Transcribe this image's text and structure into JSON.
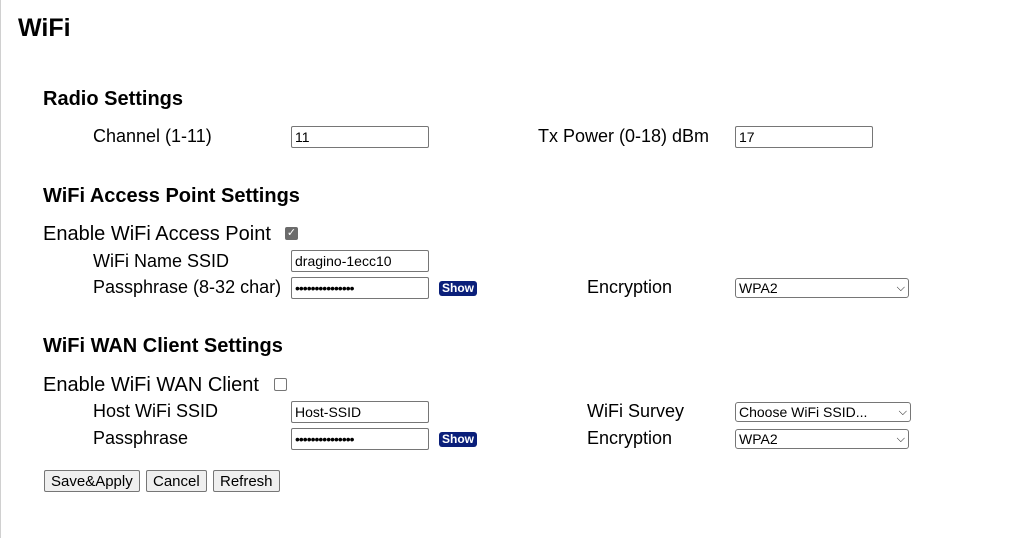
{
  "page": {
    "title": "WiFi"
  },
  "radio": {
    "title": "Radio Settings",
    "channel_label": "Channel (1-11)",
    "channel_value": "11",
    "txpower_label": "Tx Power (0-18) dBm",
    "txpower_value": "17"
  },
  "ap": {
    "title": "WiFi Access Point Settings",
    "enable_label": "Enable WiFi Access Point",
    "enabled": true,
    "ssid_label": "WiFi Name SSID",
    "ssid_value": "dragino-1ecc10",
    "pass_label": "Passphrase (8-32 char)",
    "pass_value": "•••••••••••••••",
    "show_label": "Show",
    "enc_label": "Encryption",
    "enc_value": "WPA2"
  },
  "wan": {
    "title": "WiFi WAN Client Settings",
    "enable_label": "Enable WiFi WAN Client",
    "enabled": false,
    "ssid_label": "Host WiFi SSID",
    "ssid_value": "Host-SSID",
    "survey_label": "WiFi Survey",
    "survey_value": "Choose WiFi SSID...",
    "pass_label": "Passphrase",
    "pass_value": "•••••••••••••••",
    "show_label": "Show",
    "enc_label": "Encryption",
    "enc_value": "WPA2"
  },
  "actions": {
    "save_label": "Save&Apply",
    "cancel_label": "Cancel",
    "refresh_label": "Refresh"
  },
  "colors": {
    "show_button": "#0a1f7a"
  },
  "icons": {
    "dropdown": "chevron-down-icon",
    "check": "checkmark-icon"
  }
}
